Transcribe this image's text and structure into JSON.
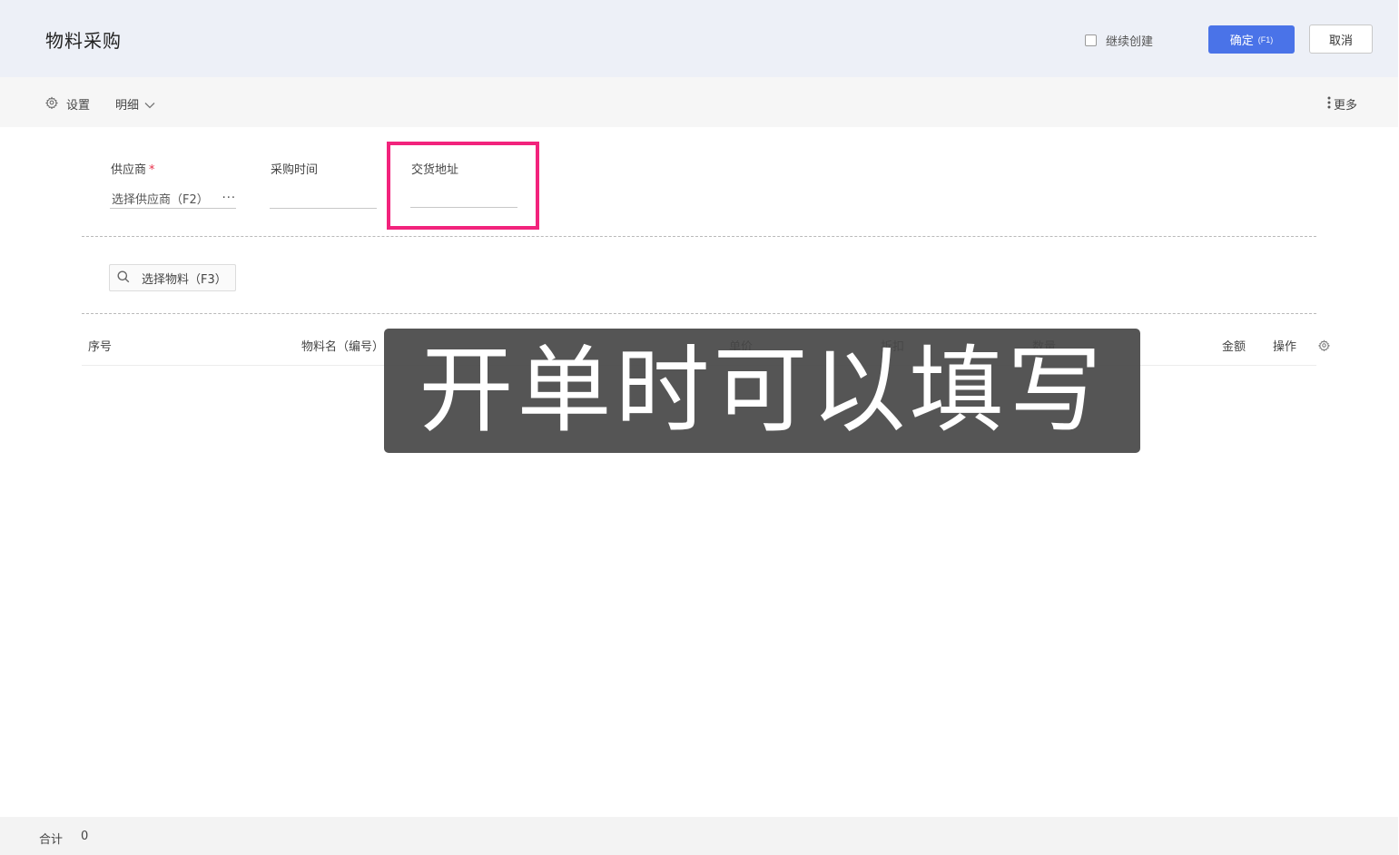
{
  "header": {
    "title": "物料采购",
    "continue_create_label": "继续创建",
    "confirm_label": "确定",
    "confirm_hotkey": "(F1)",
    "cancel_label": "取消"
  },
  "toolbar": {
    "settings_label": "设置",
    "detail_label": "明细",
    "more_label": "更多"
  },
  "form": {
    "supplier": {
      "label": "供应商",
      "required_mark": "*",
      "placeholder": "选择供应商（F2）",
      "more": "···"
    },
    "purchase_time": {
      "label": "采购时间",
      "value": ""
    },
    "delivery_address": {
      "label": "交货地址",
      "value": ""
    }
  },
  "material_search": {
    "placeholder": "选择物料（F3）"
  },
  "table": {
    "columns": [
      "序号",
      "物料名（编号）",
      "单价",
      "折扣",
      "数量",
      "金额",
      "操作"
    ],
    "rows": []
  },
  "overlay": {
    "caption": "开单时可以填写"
  },
  "footer": {
    "total_label": "合计",
    "total_value": "0"
  },
  "colors": {
    "accent": "#4a73e8",
    "highlight": "#f2237c",
    "required": "#e8304a"
  }
}
